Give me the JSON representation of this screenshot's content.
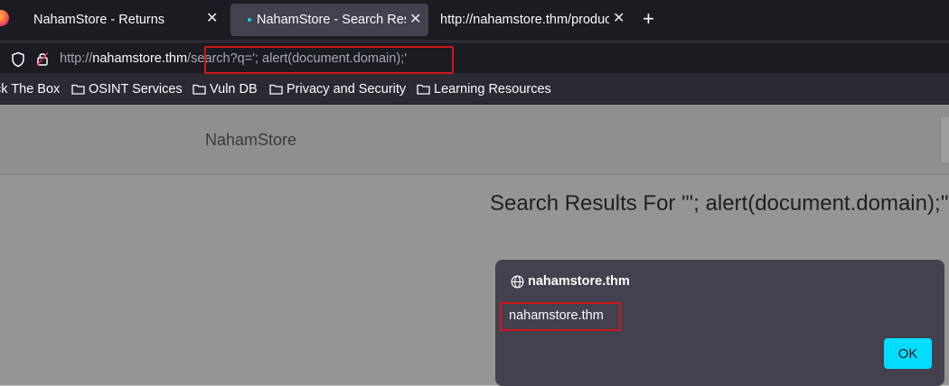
{
  "tabs": [
    {
      "title": "NahamStore - Returns",
      "close": "✕"
    },
    {
      "title": "NahamStore - Search Results",
      "close": "✕"
    },
    {
      "title": "http://nahamstore.thm/product",
      "close": "✕"
    }
  ],
  "new_tab": "+",
  "urlbar": {
    "prefix": "http://",
    "host": "nahamstore.thm",
    "path": "/search?q='; alert(document.domain);'"
  },
  "bookmarks": [
    {
      "label": "ck The Box",
      "has_folder": false
    },
    {
      "label": "OSINT Services",
      "has_folder": true
    },
    {
      "label": "Vuln DB",
      "has_folder": true
    },
    {
      "label": "Privacy and Security",
      "has_folder": true
    },
    {
      "label": "Learning Resources",
      "has_folder": true
    }
  ],
  "site": {
    "brand": "NahamStore",
    "heading": "Search Results For \"'; alert(document.domain);'\""
  },
  "dialog": {
    "origin": "nahamstore.thm",
    "message": "nahamstore.thm",
    "ok_label": "OK"
  },
  "colors": {
    "accent": "#00ddff",
    "highlight_box": "#d0161b",
    "chrome_dark": "#1c1b22",
    "chrome": "#2b2a33",
    "dialog_bg": "#42414d"
  },
  "icons": [
    "firefox-logo-icon",
    "shield-icon",
    "lock-icon",
    "folder-icon",
    "globe-icon",
    "close-icon",
    "plus-icon"
  ]
}
